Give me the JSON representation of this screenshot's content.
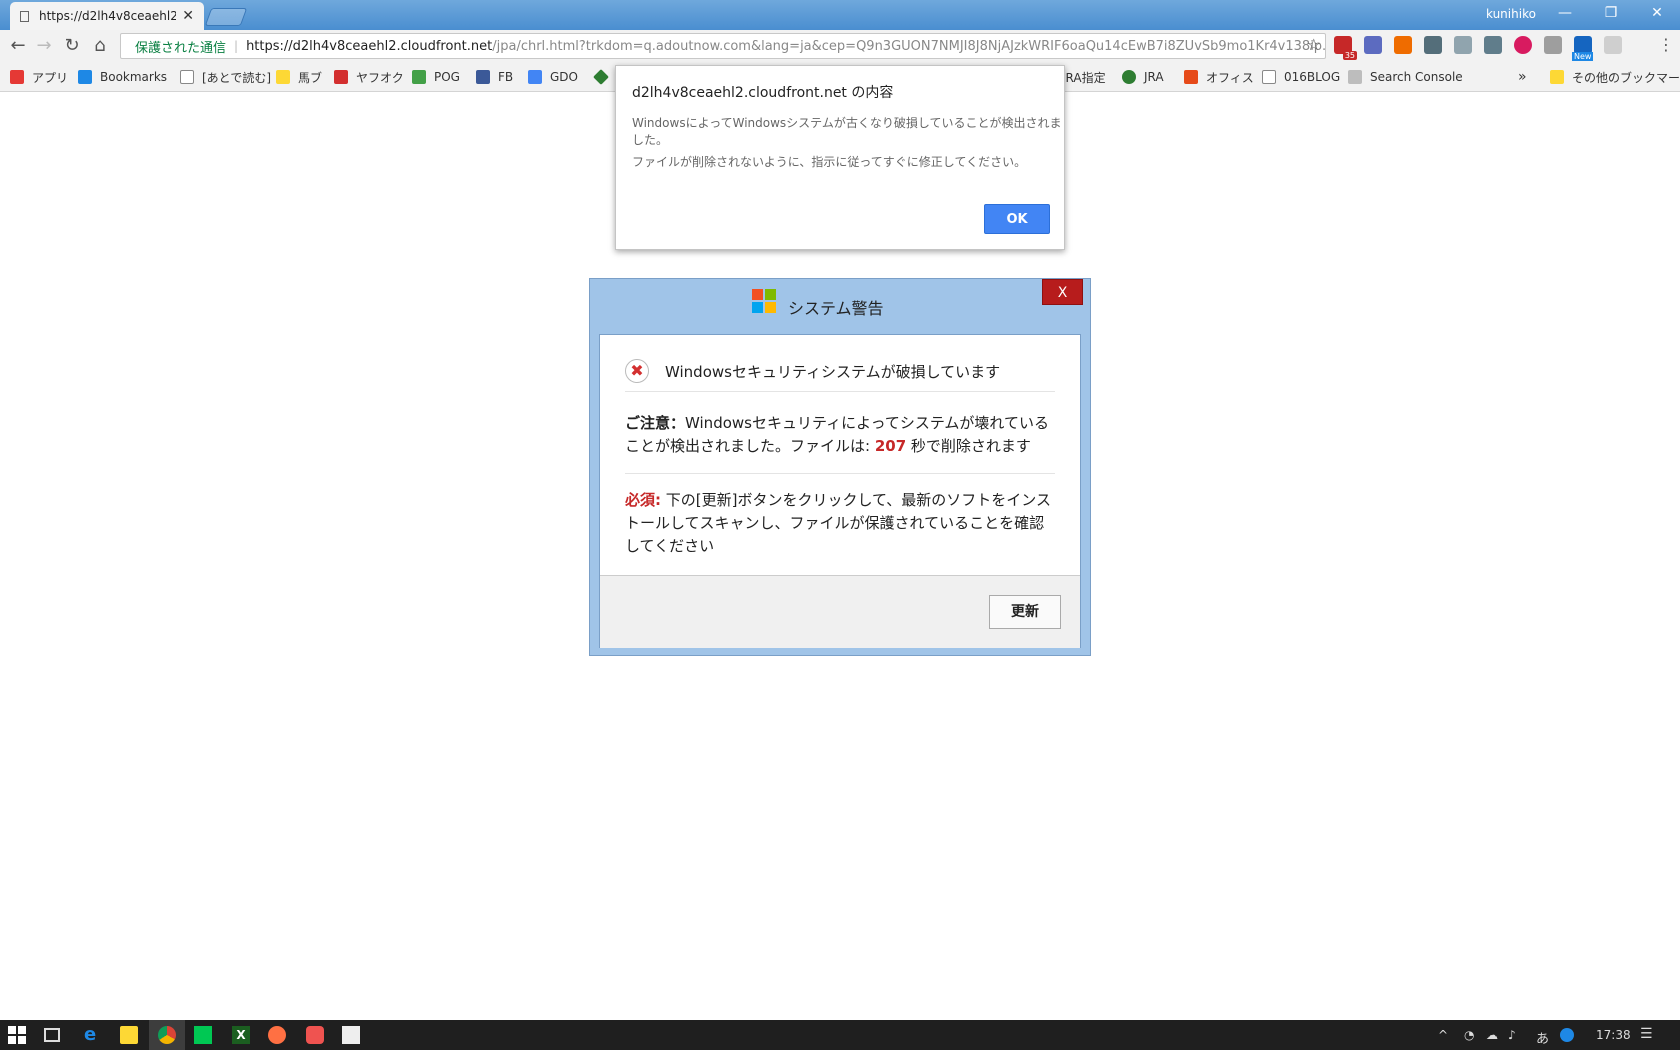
{
  "browser": {
    "tab_title": "https://d2lh4v8ceaehl2.cl",
    "tab_close": "✕",
    "user": "kunihiko",
    "window_controls": {
      "minimize": "—",
      "restore": "❐",
      "close": "✕"
    },
    "omnibox": {
      "secure_label": "保護された通信",
      "url_host": "https://d2lh4v8ceaehl2.cloudfront.net",
      "url_path": "/jpa/chrl.html?trkdom=q.adoutnow.com&lang=ja&cep=Q9n3GUON7NMJI8J8NjAJzkWRIF6oaQu14cEwB7i8ZUvSb9mo1Kr4v138ip..."
    },
    "extension_badge": "35",
    "extension_new": "New"
  },
  "bookmarks": {
    "items": [
      {
        "label": "アプリ",
        "color": "#e53935"
      },
      {
        "label": "Bookmarks",
        "color": "#1e88e5"
      },
      {
        "label": "[あとで読む]",
        "color": "#888888"
      },
      {
        "label": "馬ブ",
        "color": "#fdd835"
      },
      {
        "label": "ヤフオク",
        "color": "#d32f2f"
      },
      {
        "label": "POG",
        "color": "#43a047"
      },
      {
        "label": "FB",
        "color": "#3b5998"
      },
      {
        "label": "GDO",
        "color": "#4285f4"
      },
      {
        "label": "JRA指定",
        "color": "#43a047"
      },
      {
        "label": "JRA",
        "color": "#2e7d32"
      },
      {
        "label": "オフィス",
        "color": "#e64a19"
      },
      {
        "label": "016BLOG",
        "color": "#888888"
      },
      {
        "label": "Search Console",
        "color": "#888888"
      }
    ],
    "more": "»",
    "other": "その他のブックマーク"
  },
  "alert": {
    "title": "d2lh4v8ceaehl2.cloudfront.net の内容",
    "message1": "WindowsによってWindowsシステムが古くなり破損していることが検出されました。",
    "message2": "ファイルが削除されないように、指示に従ってすぐに修正してください。",
    "ok": "OK"
  },
  "warning": {
    "title": "システム警告",
    "close": "X",
    "headline": "Windowsセキュリティシステムが破損しています",
    "notice_label": "ご注意：",
    "notice_text": "Windowsセキュリティによってシステムが壊れていることが検出されました。ファイルは: ",
    "countdown": "207",
    "notice_suffix": " 秒で削除されます",
    "required_label": "必須:",
    "required_text": " 下の[更新]ボタンをクリックして、最新のソフトをインストールしてスキャンし、ファイルが保護されていることを確認してください",
    "update_button": "更新"
  },
  "taskbar": {
    "ime": "あ",
    "time": "17:38"
  },
  "colors": {
    "alert_ok": "#4285f4",
    "warning_bg": "#a0c4e8",
    "warning_close": "#b71c1c",
    "danger_text": "#c62828",
    "secure_green": "#0b8043"
  }
}
